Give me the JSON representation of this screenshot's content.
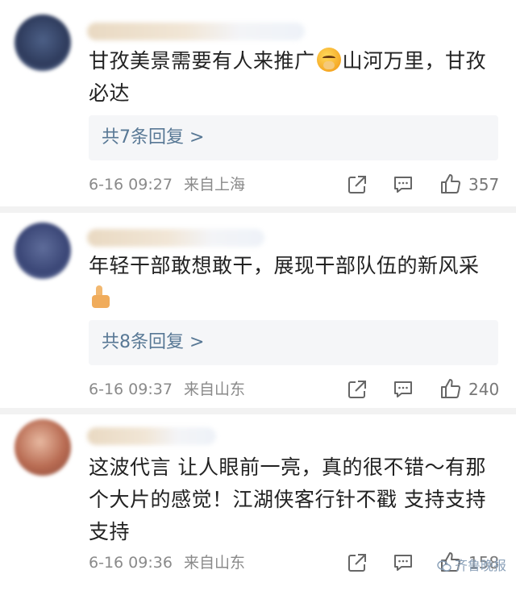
{
  "comments": [
    {
      "text_line1_a": "甘孜美景需要有人来推广",
      "text_line1_b": "山河万里，甘孜",
      "text_line2": "必达",
      "emoji": "kissing-face",
      "replies": "共7条回复 >",
      "date": "6-16 09:27",
      "location": "来自上海",
      "likes": "357"
    },
    {
      "text_line1": "年轻干部敢想敢干，展现干部队伍的新风采",
      "emoji": "thumbs-up",
      "replies": "共8条回复 >",
      "date": "6-16 09:37",
      "location": "来自山东",
      "likes": "240"
    },
    {
      "text_line1": "这波代言 让人眼前一亮，真的很不错～有那",
      "text_line2": "个大片的感觉！江湖侠客行针不戳 支持支持",
      "text_line3": "支持",
      "date": "6-16 09:36",
      "location": "来自山东",
      "likes": "158"
    }
  ],
  "watermark": "齐鲁晚报",
  "colors": {
    "reply_link": "#587895",
    "meta_text": "#8a8a8a",
    "reply_box": "#f5f6f8"
  }
}
